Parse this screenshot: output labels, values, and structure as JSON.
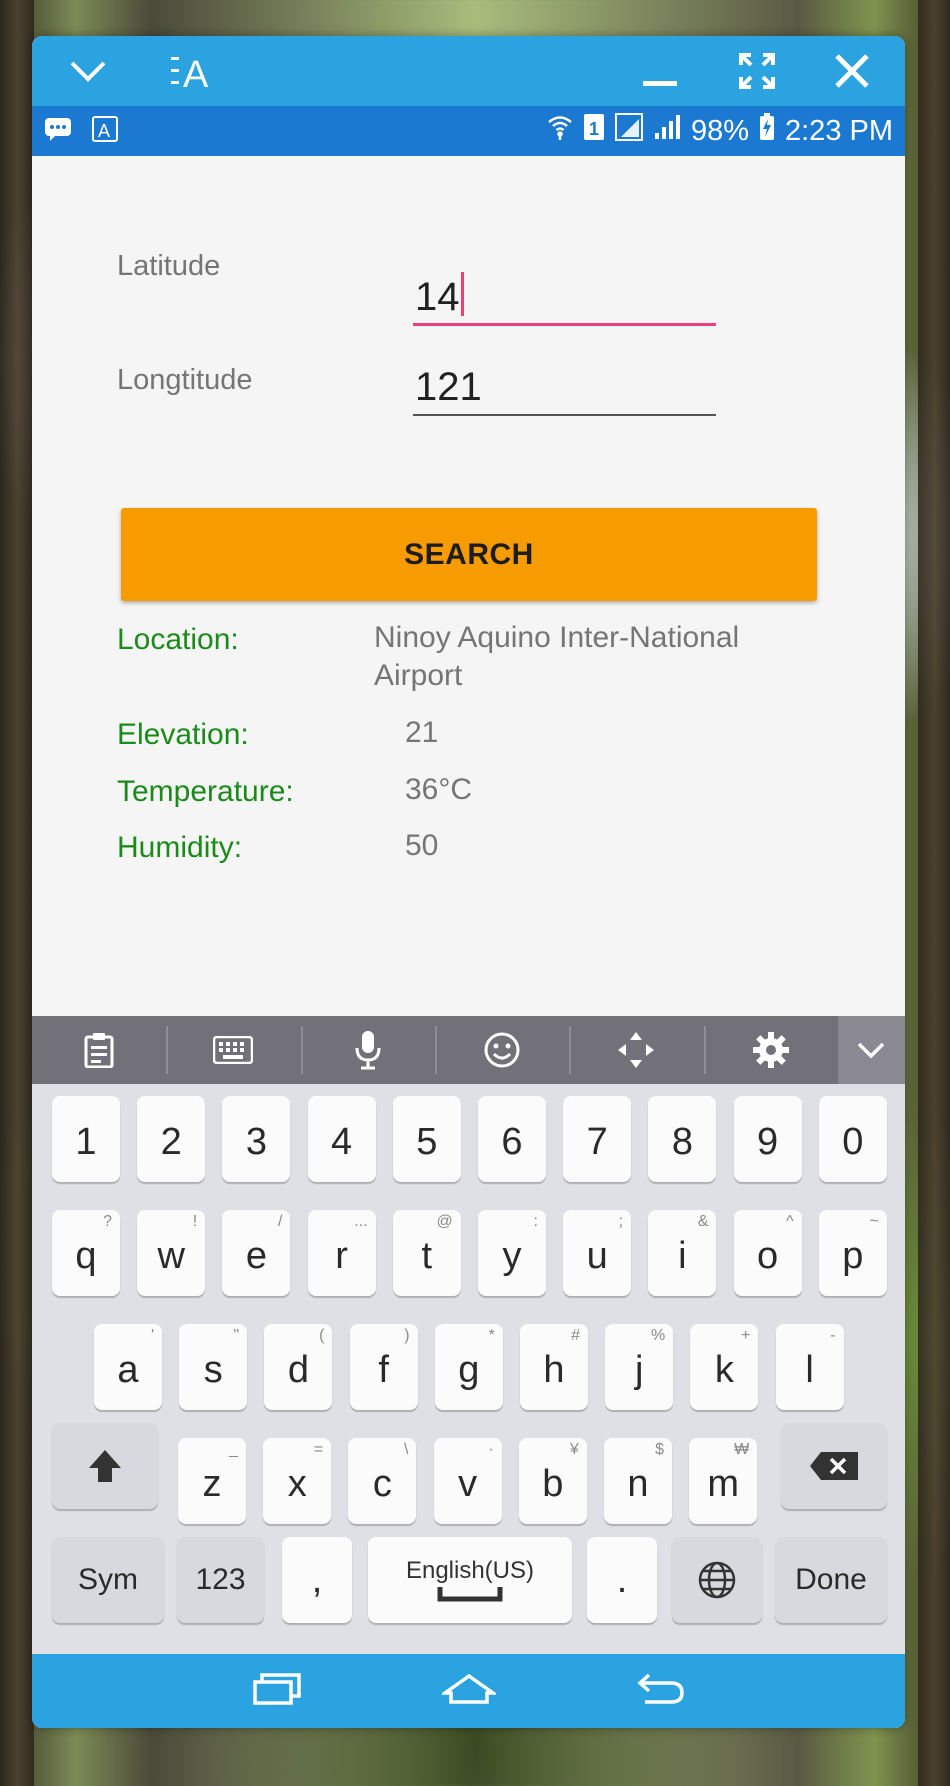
{
  "status_bar": {
    "battery": "98%",
    "time": "2:23 PM"
  },
  "form": {
    "latitude_label": "Latitude",
    "latitude_value": "14",
    "longitude_label": "Longtitude",
    "longitude_value": "121",
    "search_label": "SEARCH"
  },
  "results": {
    "location_label": "Location:",
    "location_value_line1": "Ninoy Aquino Inter-National",
    "location_value_line2": "Airport",
    "elevation_label": "Elevation:",
    "elevation_value": "21",
    "temperature_label": "Temperature:",
    "temperature_value": "36°C",
    "humidity_label": "Humidity:",
    "humidity_value": "50"
  },
  "keyboard": {
    "numbers": [
      "1",
      "2",
      "3",
      "4",
      "5",
      "6",
      "7",
      "8",
      "9",
      "0"
    ],
    "row1": [
      {
        "key": "q",
        "sub": "?"
      },
      {
        "key": "w",
        "sub": "!"
      },
      {
        "key": "e",
        "sub": "/"
      },
      {
        "key": "r",
        "sub": "..."
      },
      {
        "key": "t",
        "sub": "@"
      },
      {
        "key": "y",
        "sub": ":"
      },
      {
        "key": "u",
        "sub": ";"
      },
      {
        "key": "i",
        "sub": "&"
      },
      {
        "key": "o",
        "sub": "^"
      },
      {
        "key": "p",
        "sub": "~"
      }
    ],
    "row2": [
      {
        "key": "a",
        "sub": "'"
      },
      {
        "key": "s",
        "sub": "\""
      },
      {
        "key": "d",
        "sub": "("
      },
      {
        "key": "f",
        "sub": ")"
      },
      {
        "key": "g",
        "sub": "*"
      },
      {
        "key": "h",
        "sub": "#"
      },
      {
        "key": "j",
        "sub": "%"
      },
      {
        "key": "k",
        "sub": "+"
      },
      {
        "key": "l",
        "sub": "-"
      }
    ],
    "row3": [
      {
        "key": "z",
        "sub": "_"
      },
      {
        "key": "x",
        "sub": "="
      },
      {
        "key": "c",
        "sub": "\\"
      },
      {
        "key": "v",
        "sub": "·"
      },
      {
        "key": "b",
        "sub": "¥"
      },
      {
        "key": "n",
        "sub": "$"
      },
      {
        "key": "m",
        "sub": "₩"
      }
    ],
    "sym_label": "Sym",
    "num_label": "123",
    "comma_label": ",",
    "space_label": "English(US)",
    "period_label": ".",
    "done_label": "Done"
  }
}
